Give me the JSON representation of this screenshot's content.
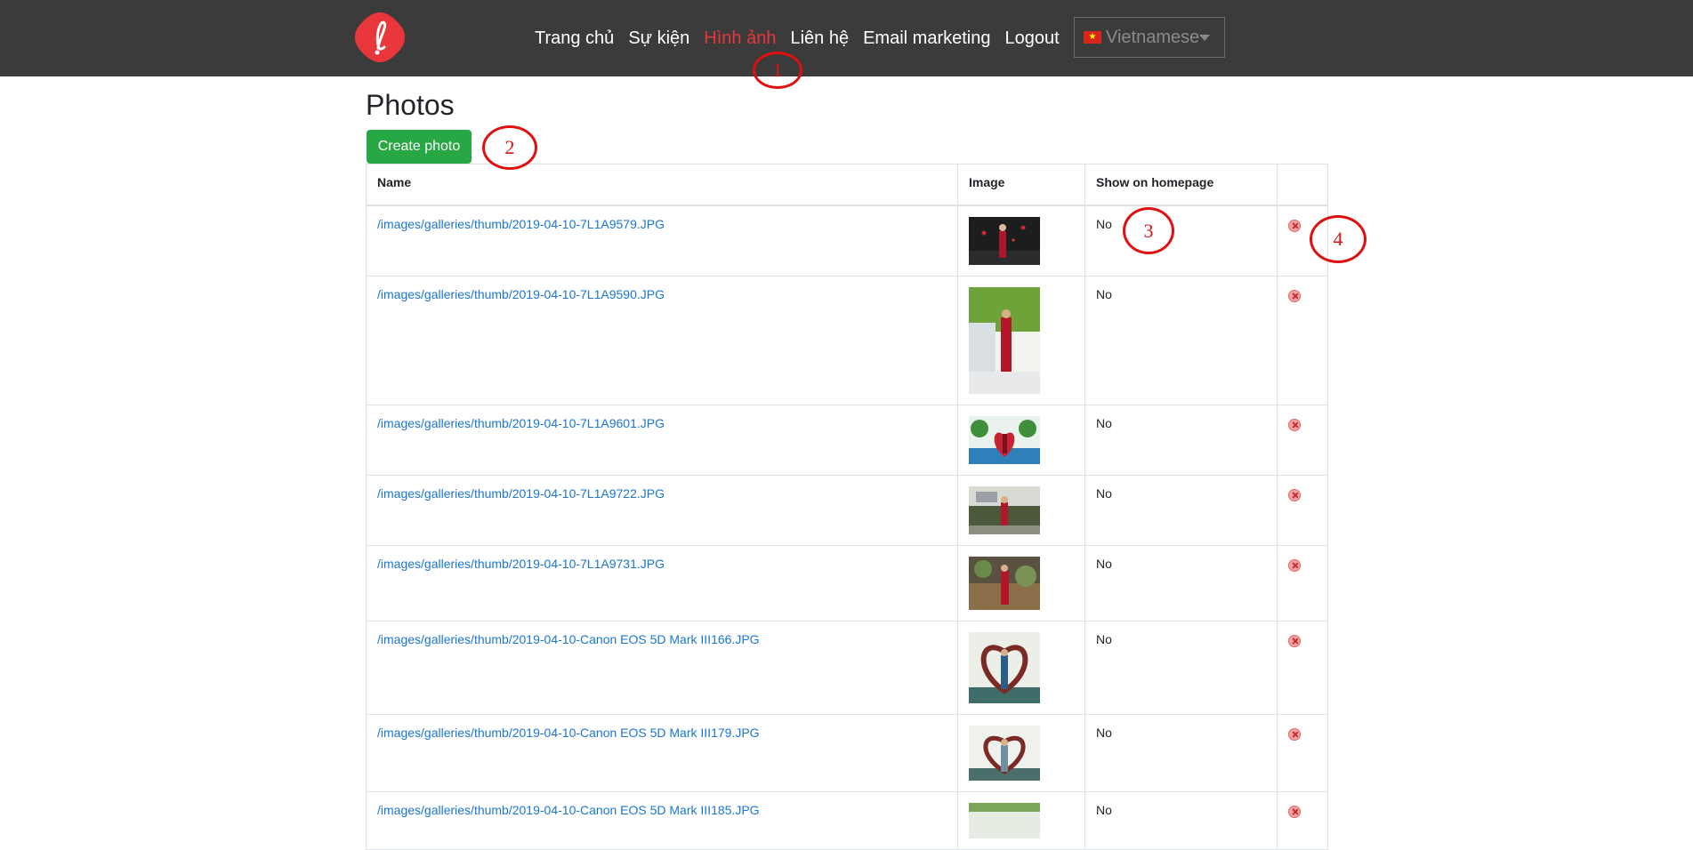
{
  "nav": {
    "items": [
      {
        "label": "Trang chủ",
        "active": false
      },
      {
        "label": "Sự kiện",
        "active": false
      },
      {
        "label": "Hình ảnh",
        "active": true
      },
      {
        "label": "Liên hệ",
        "active": false
      },
      {
        "label": "Email marketing",
        "active": false
      },
      {
        "label": "Logout",
        "active": false
      }
    ],
    "language": {
      "selected": "Vietnamese",
      "flag_icon": "vietnam-flag-icon"
    },
    "active_color": "#e8363b",
    "background": "#3b3b3b"
  },
  "page": {
    "title": "Photos",
    "create_button_label": "Create photo"
  },
  "table": {
    "columns": [
      "Name",
      "Image",
      "Show on homepage",
      ""
    ],
    "rows": [
      {
        "name": "/images/galleries/thumb/2019-04-10-7L1A9579.JPG",
        "show": "No"
      },
      {
        "name": "/images/galleries/thumb/2019-04-10-7L1A9590.JPG",
        "show": "No"
      },
      {
        "name": "/images/galleries/thumb/2019-04-10-7L1A9601.JPG",
        "show": "No"
      },
      {
        "name": "/images/galleries/thumb/2019-04-10-7L1A9722.JPG",
        "show": "No"
      },
      {
        "name": "/images/galleries/thumb/2019-04-10-7L1A9731.JPG",
        "show": "No"
      },
      {
        "name": "/images/galleries/thumb/2019-04-10-Canon EOS 5D Mark III166.JPG",
        "show": "No"
      },
      {
        "name": "/images/galleries/thumb/2019-04-10-Canon EOS 5D Mark III179.JPG",
        "show": "No"
      },
      {
        "name": "/images/galleries/thumb/2019-04-10-Canon EOS 5D Mark III185.JPG",
        "show": "No"
      }
    ]
  },
  "annotations": [
    "1",
    "2",
    "3",
    "4"
  ],
  "colors": {
    "brand": "#e8363b",
    "button": "#28a745",
    "link": "#1a76d2"
  }
}
